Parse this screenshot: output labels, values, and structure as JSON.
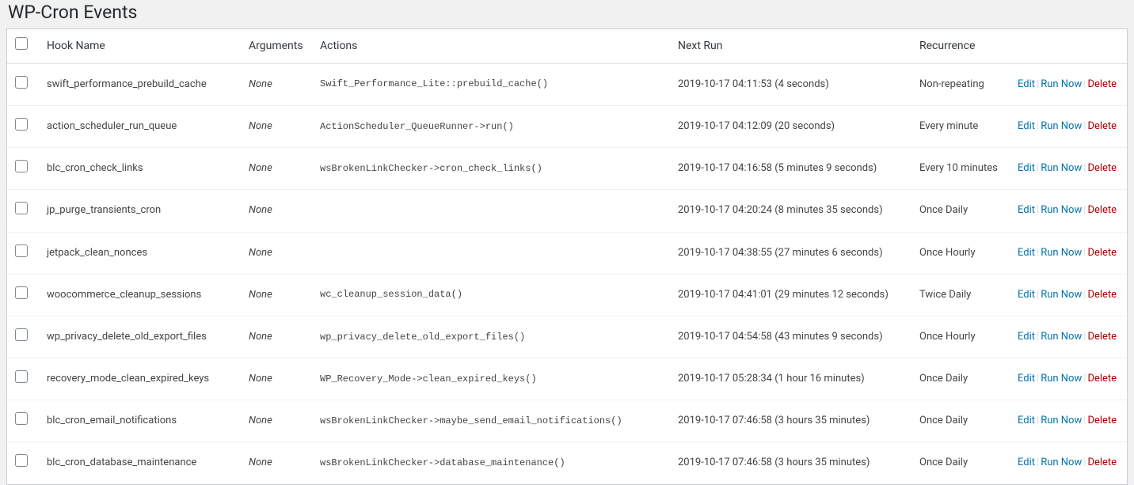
{
  "heading": "WP-Cron Events",
  "columns": {
    "hook": "Hook Name",
    "args": "Arguments",
    "actions": "Actions",
    "next": "Next Run",
    "recur": "Recurrence"
  },
  "ops": {
    "edit": "Edit",
    "run": "Run Now",
    "delete": "Delete"
  },
  "rows": [
    {
      "hook": "swift_performance_prebuild_cache",
      "args": "None",
      "action": "Swift_Performance_Lite::prebuild_cache()",
      "next": "2019-10-17 04:11:53 (4 seconds)",
      "recur": "Non-repeating"
    },
    {
      "hook": "action_scheduler_run_queue",
      "args": "None",
      "action": "ActionScheduler_QueueRunner->run()",
      "next": "2019-10-17 04:12:09 (20 seconds)",
      "recur": "Every minute"
    },
    {
      "hook": "blc_cron_check_links",
      "args": "None",
      "action": "wsBrokenLinkChecker->cron_check_links()",
      "next": "2019-10-17 04:16:58 (5 minutes 9 seconds)",
      "recur": "Every 10 minutes"
    },
    {
      "hook": "jp_purge_transients_cron",
      "args": "None",
      "action": "",
      "next": "2019-10-17 04:20:24 (8 minutes 35 seconds)",
      "recur": "Once Daily"
    },
    {
      "hook": "jetpack_clean_nonces",
      "args": "None",
      "action": "",
      "next": "2019-10-17 04:38:55 (27 minutes 6 seconds)",
      "recur": "Once Hourly"
    },
    {
      "hook": "woocommerce_cleanup_sessions",
      "args": "None",
      "action": "wc_cleanup_session_data()",
      "next": "2019-10-17 04:41:01 (29 minutes 12 seconds)",
      "recur": "Twice Daily"
    },
    {
      "hook": "wp_privacy_delete_old_export_files",
      "args": "None",
      "action": "wp_privacy_delete_old_export_files()",
      "next": "2019-10-17 04:54:58 (43 minutes 9 seconds)",
      "recur": "Once Hourly"
    },
    {
      "hook": "recovery_mode_clean_expired_keys",
      "args": "None",
      "action": "WP_Recovery_Mode->clean_expired_keys()",
      "next": "2019-10-17 05:28:34 (1 hour 16 minutes)",
      "recur": "Once Daily"
    },
    {
      "hook": "blc_cron_email_notifications",
      "args": "None",
      "action": "wsBrokenLinkChecker->maybe_send_email_notifications()",
      "next": "2019-10-17 07:46:58 (3 hours 35 minutes)",
      "recur": "Once Daily"
    },
    {
      "hook": "blc_cron_database_maintenance",
      "args": "None",
      "action": "wsBrokenLinkChecker->database_maintenance()",
      "next": "2019-10-17 07:46:58 (3 hours 35 minutes)",
      "recur": "Once Daily"
    }
  ]
}
